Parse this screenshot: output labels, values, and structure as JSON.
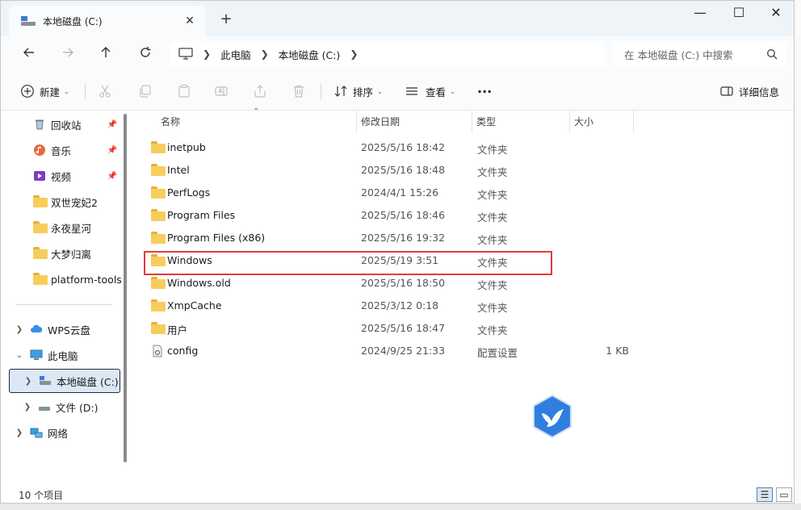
{
  "window": {
    "tab_title": "本地磁盘 (C:)",
    "close_tab": "✕",
    "new_tab": "+",
    "minimize": "—",
    "maximize": "☐",
    "close": "✕"
  },
  "address": {
    "crumbs": [
      "此电脑",
      "本地磁盘 (C:)"
    ],
    "search_placeholder": "在 本地磁盘 (C:) 中搜索"
  },
  "toolbar": {
    "new_label": "新建",
    "sort_label": "排序",
    "view_label": "查看",
    "more_label": "···",
    "details_label": "详细信息"
  },
  "nav": {
    "quick": [
      {
        "label": "回收站",
        "pinned": true,
        "icon": "recycle-bin-icon"
      },
      {
        "label": "音乐",
        "pinned": true,
        "icon": "music-icon"
      },
      {
        "label": "视频",
        "pinned": true,
        "icon": "video-icon"
      },
      {
        "label": "双世宠妃2",
        "pinned": false,
        "icon": "folder-icon"
      },
      {
        "label": "永夜星河",
        "pinned": false,
        "icon": "folder-icon"
      },
      {
        "label": "大梦归离",
        "pinned": false,
        "icon": "folder-icon"
      },
      {
        "label": "platform-tools",
        "pinned": false,
        "icon": "folder-icon"
      }
    ],
    "tree": [
      {
        "label": "WPS云盘",
        "icon": "cloud-icon"
      },
      {
        "label": "此电脑",
        "icon": "computer-icon"
      },
      {
        "label": "本地磁盘 (C:)",
        "icon": "drive-icon"
      },
      {
        "label": "文件 (D:)",
        "icon": "drive-icon"
      },
      {
        "label": "网络",
        "icon": "network-icon"
      }
    ]
  },
  "columns": {
    "name": "名称",
    "date": "修改日期",
    "type": "类型",
    "size": "大小"
  },
  "files": [
    {
      "name": "inetpub",
      "date": "2025/5/16 18:42",
      "type": "文件夹",
      "size": ""
    },
    {
      "name": "Intel",
      "date": "2025/5/16 18:48",
      "type": "文件夹",
      "size": ""
    },
    {
      "name": "PerfLogs",
      "date": "2024/4/1 15:26",
      "type": "文件夹",
      "size": ""
    },
    {
      "name": "Program Files",
      "date": "2025/5/16 18:46",
      "type": "文件夹",
      "size": ""
    },
    {
      "name": "Program Files (x86)",
      "date": "2025/5/16 19:32",
      "type": "文件夹",
      "size": ""
    },
    {
      "name": "Windows",
      "date": "2025/5/19 3:51",
      "type": "文件夹",
      "size": ""
    },
    {
      "name": "Windows.old",
      "date": "2025/5/16 18:50",
      "type": "文件夹",
      "size": ""
    },
    {
      "name": "XmpCache",
      "date": "2025/3/12 0:18",
      "type": "文件夹",
      "size": ""
    },
    {
      "name": "用户",
      "date": "2025/5/16 18:47",
      "type": "文件夹",
      "size": ""
    },
    {
      "name": "config",
      "date": "2024/9/25 21:33",
      "type": "配置设置",
      "size": "1 KB"
    }
  ],
  "status": {
    "count": "10 个项目"
  },
  "colors": {
    "highlight": "#e23b3b",
    "selected_bg": "#dce8f5",
    "folder": "#f7cd5b"
  }
}
